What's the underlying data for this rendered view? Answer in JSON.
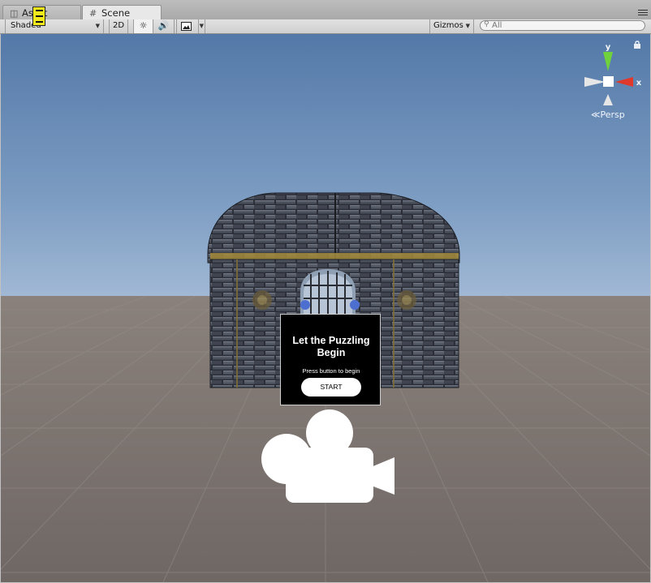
{
  "tabs": [
    {
      "label": "Asset Store",
      "icon": "asset-store-icon",
      "active": false
    },
    {
      "label": "Scene",
      "icon": "scene-grid-icon",
      "active": true
    }
  ],
  "toolbar": {
    "shading_mode": "Shaded",
    "btn_2d": "2D",
    "lighting_icon": "sun-icon",
    "audio_icon": "speaker-icon",
    "effects_icon": "image-icon",
    "gizmos_label": "Gizmos",
    "search_placeholder": "All"
  },
  "viewport": {
    "axis_labels": {
      "y": "y",
      "x": "x"
    },
    "projection": "Persp",
    "ui_canvas": {
      "title": "Let the Puzzling Begin",
      "subtitle": "Press button to begin",
      "button_label": "START"
    },
    "camera_icon": "camera-icon"
  },
  "colors": {
    "sky_top": "#5479a8",
    "horizon": "#b2c5dd",
    "ground": "#7a716d",
    "axis_x": "#e0382b",
    "axis_y": "#6fd13b",
    "badge": "#f4ea1c"
  }
}
